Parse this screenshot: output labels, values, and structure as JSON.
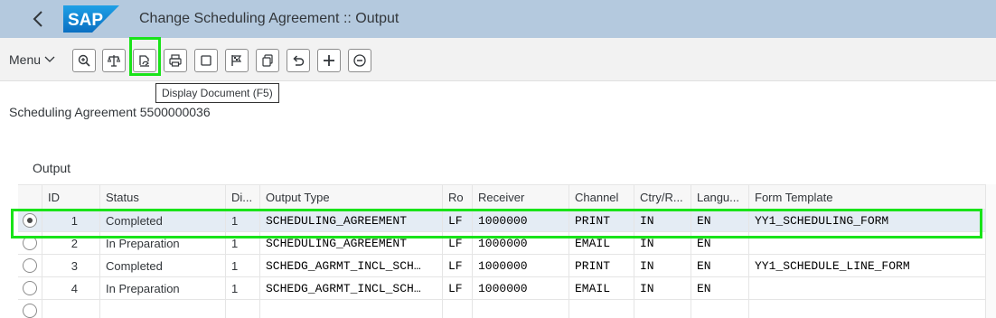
{
  "shell": {
    "title": "Change Scheduling Agreement :: Output",
    "logo_text": "SAP"
  },
  "toolbar": {
    "menu_label": "Menu",
    "buttons": [
      "zoom-icon",
      "balance-icon",
      "display-document-icon",
      "print-icon",
      "square-icon",
      "flag-icon",
      "copy-icon",
      "undo-icon",
      "plus-icon",
      "minus-icon"
    ]
  },
  "tooltip": {
    "text": "Display Document (F5)"
  },
  "subtitle": "Scheduling Agreement 5500000036",
  "section_title": "Output",
  "table": {
    "columns": [
      "ID",
      "Status",
      "Di...",
      "Output Type",
      "Ro",
      "Receiver",
      "Channel",
      "Ctry/R...",
      "Langu...",
      "Form Template"
    ],
    "rows": [
      {
        "selected": true,
        "id": "1",
        "status": "Completed",
        "di": "1",
        "output_type": "SCHEDULING_AGREEMENT",
        "ro": "LF",
        "receiver": "1000000",
        "channel": "PRINT",
        "ctry": "IN",
        "lang": "EN",
        "form": "YY1_SCHEDULING_FORM"
      },
      {
        "selected": false,
        "id": "2",
        "status": "In Preparation",
        "di": "1",
        "output_type": "SCHEDULING_AGREEMENT",
        "ro": "LF",
        "receiver": "1000000",
        "channel": "EMAIL",
        "ctry": "IN",
        "lang": "EN",
        "form": ""
      },
      {
        "selected": false,
        "id": "3",
        "status": "Completed",
        "di": "1",
        "output_type": "SCHEDG_AGRMT_INCL_SCH…",
        "ro": "LF",
        "receiver": "1000000",
        "channel": "PRINT",
        "ctry": "IN",
        "lang": "EN",
        "form": "YY1_SCHEDULE_LINE_FORM"
      },
      {
        "selected": false,
        "id": "4",
        "status": "In Preparation",
        "di": "1",
        "output_type": "SCHEDG_AGRMT_INCL_SCH…",
        "ro": "LF",
        "receiver": "1000000",
        "channel": "EMAIL",
        "ctry": "IN",
        "lang": "EN",
        "form": ""
      }
    ]
  },
  "colors": {
    "shell_bg": "#b4c9de",
    "highlight": "#19e319",
    "selected_row": "#e4ecf4"
  }
}
